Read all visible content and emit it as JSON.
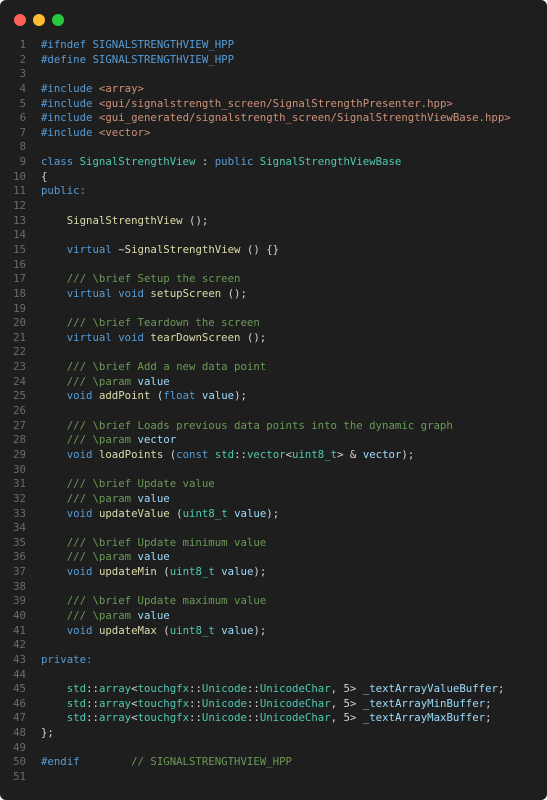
{
  "window": {
    "background": "#1e1e1e",
    "controls": [
      {
        "name": "close",
        "color": "#ff5f57"
      },
      {
        "name": "minimize",
        "color": "#febc2e"
      },
      {
        "name": "maximize",
        "color": "#28c840"
      }
    ]
  },
  "code": {
    "lines": [
      {
        "n": "1",
        "tokens": [
          {
            "t": "#ifndef",
            "c": "keyword"
          },
          {
            "t": " SIGNALSTRENGTHVIEW_HPP",
            "c": "keyword"
          }
        ]
      },
      {
        "n": "2",
        "tokens": [
          {
            "t": "#define",
            "c": "keyword"
          },
          {
            "t": " SIGNALSTRENGTHVIEW_HPP",
            "c": "keyword"
          }
        ]
      },
      {
        "n": "3",
        "tokens": []
      },
      {
        "n": "4",
        "tokens": [
          {
            "t": "#include ",
            "c": "keyword"
          },
          {
            "t": "<array>",
            "c": "string"
          }
        ]
      },
      {
        "n": "5",
        "tokens": [
          {
            "t": "#include ",
            "c": "keyword"
          },
          {
            "t": "<gui/signalstrength_screen/SignalStrengthPresenter.hpp>",
            "c": "string"
          }
        ]
      },
      {
        "n": "6",
        "tokens": [
          {
            "t": "#include ",
            "c": "keyword"
          },
          {
            "t": "<gui_generated/signalstrength_screen/SignalStrengthViewBase.hpp>",
            "c": "string"
          }
        ]
      },
      {
        "n": "7",
        "tokens": [
          {
            "t": "#include ",
            "c": "keyword"
          },
          {
            "t": "<vector>",
            "c": "string"
          }
        ]
      },
      {
        "n": "8",
        "tokens": []
      },
      {
        "n": "9",
        "tokens": [
          {
            "t": "class ",
            "c": "keyword"
          },
          {
            "t": "SignalStrengthView",
            "c": "type"
          },
          {
            "t": " : ",
            "c": "plain"
          },
          {
            "t": "public ",
            "c": "keyword"
          },
          {
            "t": "SignalStrengthViewBase",
            "c": "type"
          }
        ]
      },
      {
        "n": "10",
        "tokens": [
          {
            "t": "{",
            "c": "plain"
          }
        ]
      },
      {
        "n": "11",
        "tokens": [
          {
            "t": "public:",
            "c": "keyword"
          }
        ]
      },
      {
        "n": "12",
        "tokens": []
      },
      {
        "n": "13",
        "tokens": [
          {
            "t": "    ",
            "c": "plain"
          },
          {
            "t": "SignalStrengthView",
            "c": "function"
          },
          {
            "t": " ();",
            "c": "plain"
          }
        ]
      },
      {
        "n": "14",
        "tokens": []
      },
      {
        "n": "15",
        "tokens": [
          {
            "t": "    ",
            "c": "plain"
          },
          {
            "t": "virtual ",
            "c": "keyword"
          },
          {
            "t": "~",
            "c": "plain"
          },
          {
            "t": "SignalStrengthView",
            "c": "function"
          },
          {
            "t": " () {}",
            "c": "plain"
          }
        ]
      },
      {
        "n": "16",
        "tokens": []
      },
      {
        "n": "17",
        "tokens": [
          {
            "t": "    /// \\brief Setup the screen",
            "c": "comment"
          }
        ]
      },
      {
        "n": "18",
        "tokens": [
          {
            "t": "    ",
            "c": "plain"
          },
          {
            "t": "virtual void ",
            "c": "keyword"
          },
          {
            "t": "setupScreen",
            "c": "function"
          },
          {
            "t": " ();",
            "c": "plain"
          }
        ]
      },
      {
        "n": "19",
        "tokens": []
      },
      {
        "n": "20",
        "tokens": [
          {
            "t": "    /// \\brief Teardown the screen",
            "c": "comment"
          }
        ]
      },
      {
        "n": "21",
        "tokens": [
          {
            "t": "    ",
            "c": "plain"
          },
          {
            "t": "virtual void ",
            "c": "keyword"
          },
          {
            "t": "tearDownScreen",
            "c": "function"
          },
          {
            "t": " ();",
            "c": "plain"
          }
        ]
      },
      {
        "n": "22",
        "tokens": []
      },
      {
        "n": "23",
        "tokens": [
          {
            "t": "    /// \\brief Add a new data point",
            "c": "comment"
          }
        ]
      },
      {
        "n": "24",
        "tokens": [
          {
            "t": "    /// \\param ",
            "c": "comment"
          },
          {
            "t": "value",
            "c": "param"
          }
        ]
      },
      {
        "n": "25",
        "tokens": [
          {
            "t": "    ",
            "c": "plain"
          },
          {
            "t": "void ",
            "c": "keyword"
          },
          {
            "t": "addPoint",
            "c": "function"
          },
          {
            "t": " (",
            "c": "plain"
          },
          {
            "t": "float ",
            "c": "keyword"
          },
          {
            "t": "value",
            "c": "param"
          },
          {
            "t": ");",
            "c": "plain"
          }
        ]
      },
      {
        "n": "26",
        "tokens": []
      },
      {
        "n": "27",
        "tokens": [
          {
            "t": "    /// \\brief Loads previous data points into the dynamic graph",
            "c": "comment"
          }
        ]
      },
      {
        "n": "28",
        "tokens": [
          {
            "t": "    /// \\param ",
            "c": "comment"
          },
          {
            "t": "vector",
            "c": "param"
          }
        ]
      },
      {
        "n": "29",
        "tokens": [
          {
            "t": "    ",
            "c": "plain"
          },
          {
            "t": "void ",
            "c": "keyword"
          },
          {
            "t": "loadPoints",
            "c": "function"
          },
          {
            "t": " (",
            "c": "plain"
          },
          {
            "t": "const ",
            "c": "keyword"
          },
          {
            "t": "std",
            "c": "type"
          },
          {
            "t": "::",
            "c": "plain"
          },
          {
            "t": "vector",
            "c": "type"
          },
          {
            "t": "<",
            "c": "plain"
          },
          {
            "t": "uint8_t",
            "c": "type"
          },
          {
            "t": "> & ",
            "c": "plain"
          },
          {
            "t": "vector",
            "c": "param"
          },
          {
            "t": ");",
            "c": "plain"
          }
        ]
      },
      {
        "n": "30",
        "tokens": []
      },
      {
        "n": "31",
        "tokens": [
          {
            "t": "    /// \\brief Update value",
            "c": "comment"
          }
        ]
      },
      {
        "n": "32",
        "tokens": [
          {
            "t": "    /// \\param ",
            "c": "comment"
          },
          {
            "t": "value",
            "c": "param"
          }
        ]
      },
      {
        "n": "33",
        "tokens": [
          {
            "t": "    ",
            "c": "plain"
          },
          {
            "t": "void ",
            "c": "keyword"
          },
          {
            "t": "updateValue",
            "c": "function"
          },
          {
            "t": " (",
            "c": "plain"
          },
          {
            "t": "uint8_t ",
            "c": "type"
          },
          {
            "t": "value",
            "c": "param"
          },
          {
            "t": ");",
            "c": "plain"
          }
        ]
      },
      {
        "n": "34",
        "tokens": []
      },
      {
        "n": "35",
        "tokens": [
          {
            "t": "    /// \\brief Update minimum value",
            "c": "comment"
          }
        ]
      },
      {
        "n": "36",
        "tokens": [
          {
            "t": "    /// \\param ",
            "c": "comment"
          },
          {
            "t": "value",
            "c": "param"
          }
        ]
      },
      {
        "n": "37",
        "tokens": [
          {
            "t": "    ",
            "c": "plain"
          },
          {
            "t": "void ",
            "c": "keyword"
          },
          {
            "t": "updateMin",
            "c": "function"
          },
          {
            "t": " (",
            "c": "plain"
          },
          {
            "t": "uint8_t ",
            "c": "type"
          },
          {
            "t": "value",
            "c": "param"
          },
          {
            "t": ");",
            "c": "plain"
          }
        ]
      },
      {
        "n": "38",
        "tokens": []
      },
      {
        "n": "39",
        "tokens": [
          {
            "t": "    /// \\brief Update maximum value",
            "c": "comment"
          }
        ]
      },
      {
        "n": "40",
        "tokens": [
          {
            "t": "    /// \\param ",
            "c": "comment"
          },
          {
            "t": "value",
            "c": "param"
          }
        ]
      },
      {
        "n": "41",
        "tokens": [
          {
            "t": "    ",
            "c": "plain"
          },
          {
            "t": "void ",
            "c": "keyword"
          },
          {
            "t": "updateMax",
            "c": "function"
          },
          {
            "t": " (",
            "c": "plain"
          },
          {
            "t": "uint8_t ",
            "c": "type"
          },
          {
            "t": "value",
            "c": "param"
          },
          {
            "t": ");",
            "c": "plain"
          }
        ]
      },
      {
        "n": "42",
        "tokens": []
      },
      {
        "n": "43",
        "tokens": [
          {
            "t": "private:",
            "c": "keyword"
          }
        ]
      },
      {
        "n": "44",
        "tokens": []
      },
      {
        "n": "45",
        "tokens": [
          {
            "t": "    ",
            "c": "plain"
          },
          {
            "t": "std",
            "c": "type"
          },
          {
            "t": "::",
            "c": "plain"
          },
          {
            "t": "array",
            "c": "type"
          },
          {
            "t": "<",
            "c": "plain"
          },
          {
            "t": "touchgfx",
            "c": "type"
          },
          {
            "t": "::",
            "c": "plain"
          },
          {
            "t": "Unicode",
            "c": "type"
          },
          {
            "t": "::",
            "c": "plain"
          },
          {
            "t": "UnicodeChar",
            "c": "type"
          },
          {
            "t": ", 5> ",
            "c": "plain"
          },
          {
            "t": "_textArrayValueBuffer",
            "c": "param"
          },
          {
            "t": ";",
            "c": "plain"
          }
        ]
      },
      {
        "n": "46",
        "tokens": [
          {
            "t": "    ",
            "c": "plain"
          },
          {
            "t": "std",
            "c": "type"
          },
          {
            "t": "::",
            "c": "plain"
          },
          {
            "t": "array",
            "c": "type"
          },
          {
            "t": "<",
            "c": "plain"
          },
          {
            "t": "touchgfx",
            "c": "type"
          },
          {
            "t": "::",
            "c": "plain"
          },
          {
            "t": "Unicode",
            "c": "type"
          },
          {
            "t": "::",
            "c": "plain"
          },
          {
            "t": "UnicodeChar",
            "c": "type"
          },
          {
            "t": ", 5> ",
            "c": "plain"
          },
          {
            "t": "_textArrayMinBuffer",
            "c": "param"
          },
          {
            "t": ";",
            "c": "plain"
          }
        ]
      },
      {
        "n": "47",
        "tokens": [
          {
            "t": "    ",
            "c": "plain"
          },
          {
            "t": "std",
            "c": "type"
          },
          {
            "t": "::",
            "c": "plain"
          },
          {
            "t": "array",
            "c": "type"
          },
          {
            "t": "<",
            "c": "plain"
          },
          {
            "t": "touchgfx",
            "c": "type"
          },
          {
            "t": "::",
            "c": "plain"
          },
          {
            "t": "Unicode",
            "c": "type"
          },
          {
            "t": "::",
            "c": "plain"
          },
          {
            "t": "UnicodeChar",
            "c": "type"
          },
          {
            "t": ", 5> ",
            "c": "plain"
          },
          {
            "t": "_textArrayMaxBuffer",
            "c": "param"
          },
          {
            "t": ";",
            "c": "plain"
          }
        ]
      },
      {
        "n": "48",
        "tokens": [
          {
            "t": "};",
            "c": "plain"
          }
        ]
      },
      {
        "n": "49",
        "tokens": []
      },
      {
        "n": "50",
        "tokens": [
          {
            "t": "#endif",
            "c": "keyword"
          },
          {
            "t": "        // SIGNALSTRENGTHVIEW_HPP",
            "c": "comment"
          }
        ]
      },
      {
        "n": "51",
        "tokens": []
      }
    ]
  }
}
